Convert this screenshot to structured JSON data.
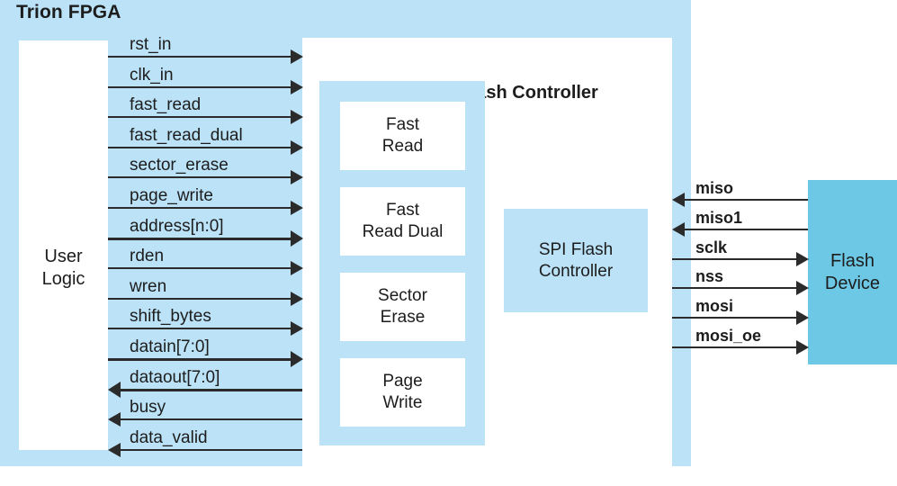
{
  "diagram": {
    "title": "Trion FPGA",
    "user_logic_label": "User\nLogic",
    "asmi_title": "ASMI SPI Flash Controller",
    "spi_controller_label": "SPI Flash\nController",
    "flash_device_label": "Flash\nDevice",
    "colors": {
      "fpga_region": "#bbe2f7",
      "inner_blue": "#bbe2f7",
      "flash_device": "#6cc8e4",
      "box_fill": "#ffffff",
      "line": "#2b2b2b",
      "text": "#1d1d1d"
    },
    "function_blocks": [
      {
        "label": "Fast\nRead",
        "line1": "Fast",
        "line2": "Read"
      },
      {
        "label": "Fast\nRead Dual",
        "line1": "Fast",
        "line2": "Read Dual"
      },
      {
        "label": "Sector\nErase",
        "line1": "Sector",
        "line2": "Erase"
      },
      {
        "label": "Page\nWrite",
        "line1": "Page",
        "line2": "Write"
      }
    ],
    "left_signals": [
      {
        "name": "rst_in",
        "direction": "right",
        "bus": false
      },
      {
        "name": "clk_in",
        "direction": "right",
        "bus": false
      },
      {
        "name": "fast_read",
        "direction": "right",
        "bus": false
      },
      {
        "name": "fast_read_dual",
        "direction": "right",
        "bus": false
      },
      {
        "name": "sector_erase",
        "direction": "right",
        "bus": false
      },
      {
        "name": "page_write",
        "direction": "right",
        "bus": false
      },
      {
        "name": "address[n:0]",
        "direction": "right",
        "bus": true
      },
      {
        "name": "rden",
        "direction": "right",
        "bus": false
      },
      {
        "name": "wren",
        "direction": "right",
        "bus": false
      },
      {
        "name": "shift_bytes",
        "direction": "right",
        "bus": false
      },
      {
        "name": "datain[7:0]",
        "direction": "right",
        "bus": true
      },
      {
        "name": "dataout[7:0]",
        "direction": "left",
        "bus": true
      },
      {
        "name": "busy",
        "direction": "left",
        "bus": false
      },
      {
        "name": "data_valid",
        "direction": "left",
        "bus": false
      }
    ],
    "right_signals": [
      {
        "name": "miso",
        "direction": "left",
        "bus": false
      },
      {
        "name": "miso1",
        "direction": "left",
        "bus": false
      },
      {
        "name": "sclk",
        "direction": "right",
        "bus": false
      },
      {
        "name": "nss",
        "direction": "right",
        "bus": false
      },
      {
        "name": "mosi",
        "direction": "right",
        "bus": false
      },
      {
        "name": "mosi_oe",
        "direction": "right",
        "bus": false
      }
    ]
  }
}
